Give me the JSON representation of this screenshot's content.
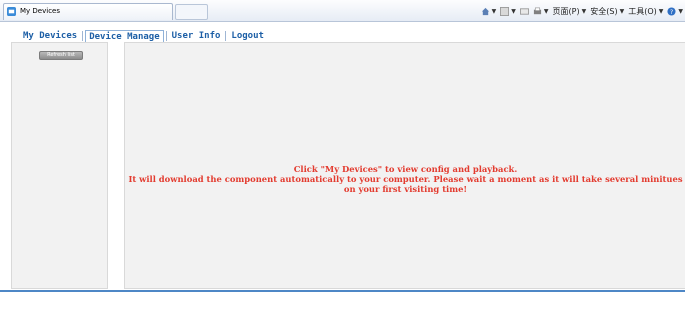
{
  "browser": {
    "tab_title": "My Devices",
    "commands": {
      "home_icon": "home-icon",
      "feeds_icon": "feeds-icon",
      "mail_icon": "mail-icon",
      "print_icon": "print-icon",
      "page_label": "页面(P)",
      "safety_label": "安全(S)",
      "tools_label": "工具(O)",
      "help_icon": "help-icon"
    }
  },
  "nav": {
    "items": [
      "My Devices",
      "Device Manage",
      "User Info",
      "Logout"
    ],
    "active_index": 1
  },
  "sidebar": {
    "refresh_label": "Refresh list"
  },
  "main": {
    "message_line1": "Click \"My Devices\" to view config and playback.",
    "message_line2": "It will download the component automatically to your computer. Please wait a moment as it will take several minitues on your first visiting time!"
  },
  "colors": {
    "nav_text": "#1d5fa6",
    "message_text": "#e33b2f",
    "panel_bg": "#f2f2f2",
    "accent_line": "#4e87c6"
  }
}
